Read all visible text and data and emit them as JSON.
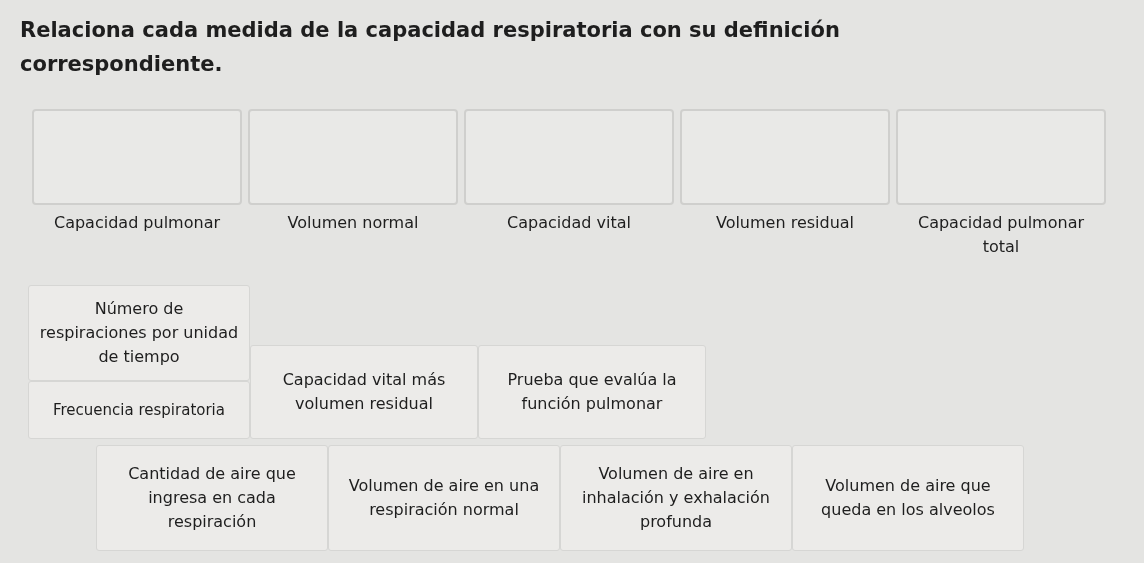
{
  "title": "Relaciona cada medida de la capacidad respiratoria con su definición correspondiente.",
  "targets": [
    {
      "label": "Capacidad pulmonar"
    },
    {
      "label": "Volumen normal"
    },
    {
      "label": "Capacidad vital"
    },
    {
      "label": "Volumen residual"
    },
    {
      "label": "Capacidad pulmonar total"
    }
  ],
  "cards_row_1": [
    "Número de respiraciones por unidad de tiempo",
    "Frecuencia respiratoria",
    "Capacidad vital más volumen residual",
    "Prueba que evalúa la función pulmonar"
  ],
  "cards_row_2": [
    "Cantidad de aire que ingresa en cada respiración",
    "Volumen de aire en una respiración normal",
    "Volumen de aire en inhalación y exhalación profunda",
    "Volumen de aire que queda en los alveolos"
  ]
}
